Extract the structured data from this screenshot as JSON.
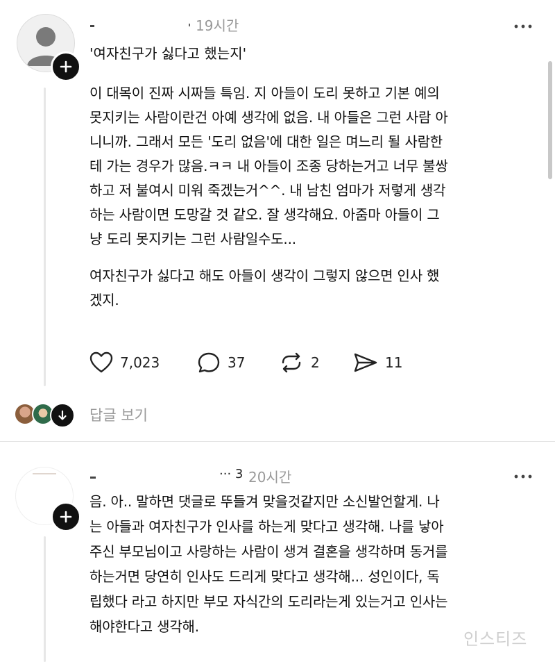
{
  "post1": {
    "time": "19시간",
    "more_icon": "more-horizontal-icon",
    "quote": "'여자친구가 싫다고 했는지'",
    "paragraph1_lines": [
      "이 대목이 진짜 시짜들 특임. 지 아들이 도리 못하고 기본 예의",
      "못지키는 사람이란건 아예 생각에 없음. 내 아들은 그런 사람 아",
      "니니까. 그래서 모든 '도리 없음'에 대한 일은 며느리 될 사람한",
      "테 가는 경우가 많음.ㅋㅋ 내 아들이 조종 당하는거고 너무 불쌍",
      "하고 저 불여시 미워 죽겠는거^^. 내 남친 엄마가 저렇게 생각",
      "하는 사람이면 도망갈 것 같오. 잘 생각해요. 아줌마 아들이 그",
      "냥 도리 못지키는 그런 사람일수도..."
    ],
    "paragraph2_lines": [
      "여자친구가 싫다고 해도 아들이 생각이 그렇지 않으면 인사 했",
      "겠지."
    ],
    "actions": {
      "likes": "7,023",
      "comments": "37",
      "reposts": "2",
      "shares": "11"
    },
    "replies_label": "답글 보기"
  },
  "post2": {
    "username_fragment": "··· 3",
    "time": "20시간",
    "body_lines": [
      "음. 아.. 말하면 댓글로 뚜들겨 맞을것같지만 소신발언할게. 나",
      "는 아들과 여자친구가 인사를 하는게 맞다고 생각해. 나를 낳아",
      "주신 부모님이고 사랑하는 사람이 생겨 결혼을 생각하며 동거를",
      "하는거면 당연히 인사도 드리게 맞다고 생각해... 성인이다, 독",
      "립했다 라고 하지만 부모 자식간의 도리라는게 있는거고 인사는",
      "해야한다고 생각해."
    ]
  },
  "watermark": "인스티즈",
  "colors": {
    "muted": "#999999",
    "text": "#111111",
    "divider": "#e3e3e3"
  }
}
